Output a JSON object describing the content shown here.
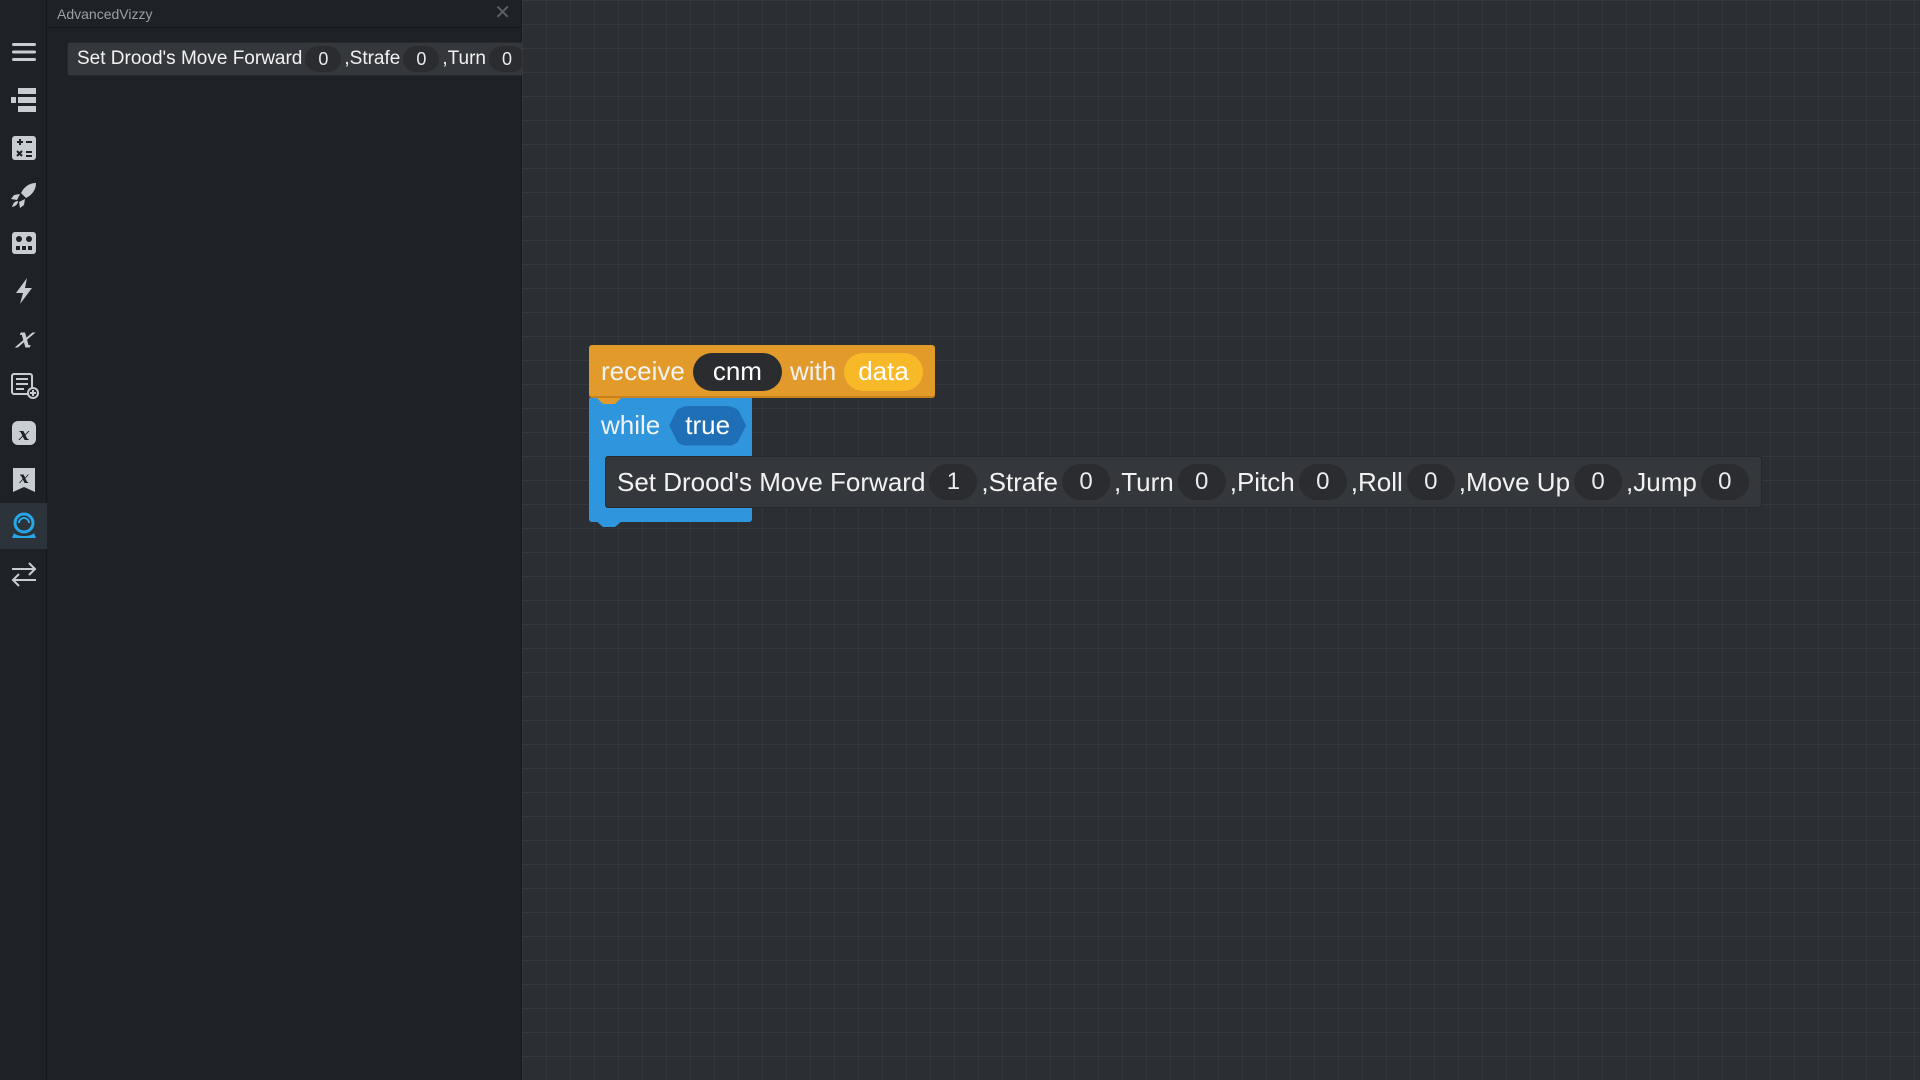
{
  "window": {
    "title": "AdvancedVizzy"
  },
  "rail": {
    "items": [
      {
        "name": "menu-icon"
      },
      {
        "name": "structure-icon"
      },
      {
        "name": "math-icon"
      },
      {
        "name": "rocket-icon"
      },
      {
        "name": "robot-icon"
      },
      {
        "name": "lightning-icon"
      },
      {
        "name": "variable-icon"
      },
      {
        "name": "list-add-icon"
      },
      {
        "name": "variable-box-icon"
      },
      {
        "name": "variable-flag-icon"
      },
      {
        "name": "drood-icon",
        "active": true
      },
      {
        "name": "swap-arrows-icon"
      }
    ]
  },
  "flyout": {
    "block": {
      "label": "Set Drood's Move Forward",
      "forward": "0",
      "strafe_label": ",Strafe",
      "strafe": "0",
      "turn_label": ",Turn",
      "turn": "0"
    }
  },
  "workspace": {
    "receive": {
      "label": "receive",
      "message": "cnm",
      "with_label": "with",
      "data": "data"
    },
    "while": {
      "label": "while",
      "condition": "true"
    },
    "set_block": {
      "label": "Set Drood's Move Forward",
      "forward": "1",
      "strafe_label": ",Strafe",
      "strafe": "0",
      "turn_label": ",Turn",
      "turn": "0",
      "pitch_label": ",Pitch",
      "pitch": "0",
      "roll_label": ",Roll",
      "roll": "0",
      "moveup_label": ",Move Up",
      "moveup": "0",
      "jump_label": ",Jump",
      "jump": "0"
    }
  },
  "colors": {
    "event_block": "#e29b2a",
    "control_block": "#2f95dc",
    "accent_active": "#27a7e6",
    "workspace_bg": "#2b2e32"
  }
}
